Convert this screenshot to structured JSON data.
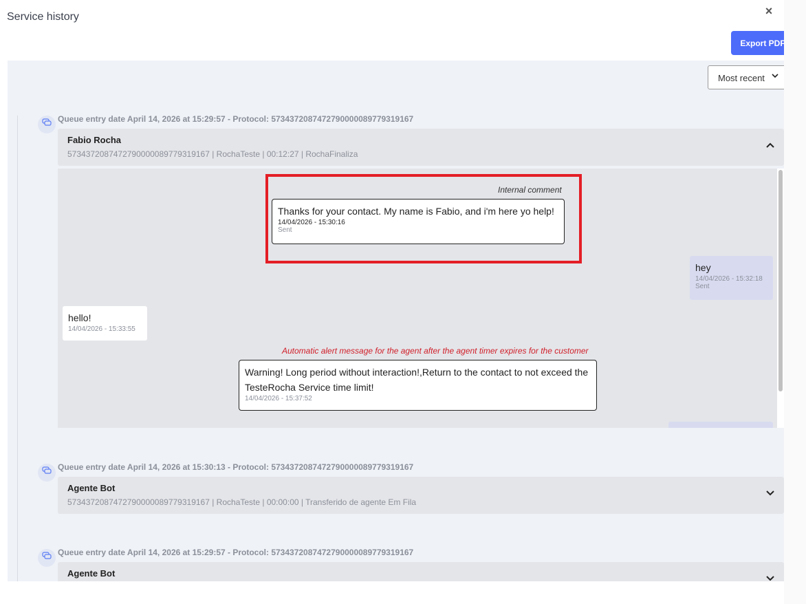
{
  "window": {
    "title": "Service history",
    "close_icon": "×",
    "export_label": "Export PDF"
  },
  "sort": {
    "selected": "Most recent",
    "chevron": "⌄"
  },
  "colors": {
    "accent": "#4d6cfa",
    "highlight": "#e41e26",
    "alert_caption": "#d0202a"
  },
  "entries": [
    {
      "header": "Queue entry date April 14, 2026 at 15:29:57 - Protocol: 5734372087472790000089779319167",
      "name": "Fabio Rocha",
      "meta": "5734372087472790000089779319167 | RochaTeste | 00:12:27 | RochaFinaliza",
      "chevron": "︿",
      "expanded": true
    },
    {
      "header": "Queue entry date April 14, 2026 at 15:30:13 - Protocol: 5734372087472790000089779319167",
      "name": "Agente Bot",
      "meta": "5734372087472790000089779319167 | RochaTeste | 00:00:00 | Transferido de agente Em Fila",
      "chevron": "﹀",
      "expanded": false
    },
    {
      "header": "Queue entry date April 14, 2026 at 15:29:57 - Protocol: 5734372087472790000089779319167",
      "name": "Agente Bot",
      "meta": "",
      "chevron": "﹀",
      "expanded": false
    }
  ],
  "messages": {
    "internal": {
      "caption": "Internal comment",
      "text": "Thanks for your contact. My name is Fabio, and i'm here yo help!",
      "time": "14/04/2026 - 15:30:16",
      "status": "Sent"
    },
    "out1": {
      "text": "hey",
      "time": "14/04/2026 - 15:32:18",
      "status": "Sent"
    },
    "in1": {
      "text": "hello!",
      "time": "14/04/2026 - 15:33:55"
    },
    "alert": {
      "caption": "Automatic alert message for the agent after the agent timer expires for the customer",
      "text": "Warning! Long period without interaction!,Return to the contact to not exceed the TesteRocha Service time limit!",
      "time": "14/04/2026 - 15:37:52"
    }
  },
  "icons": {
    "entry_icon": "chat-bubbles-icon",
    "entry_glyph": "💬"
  }
}
